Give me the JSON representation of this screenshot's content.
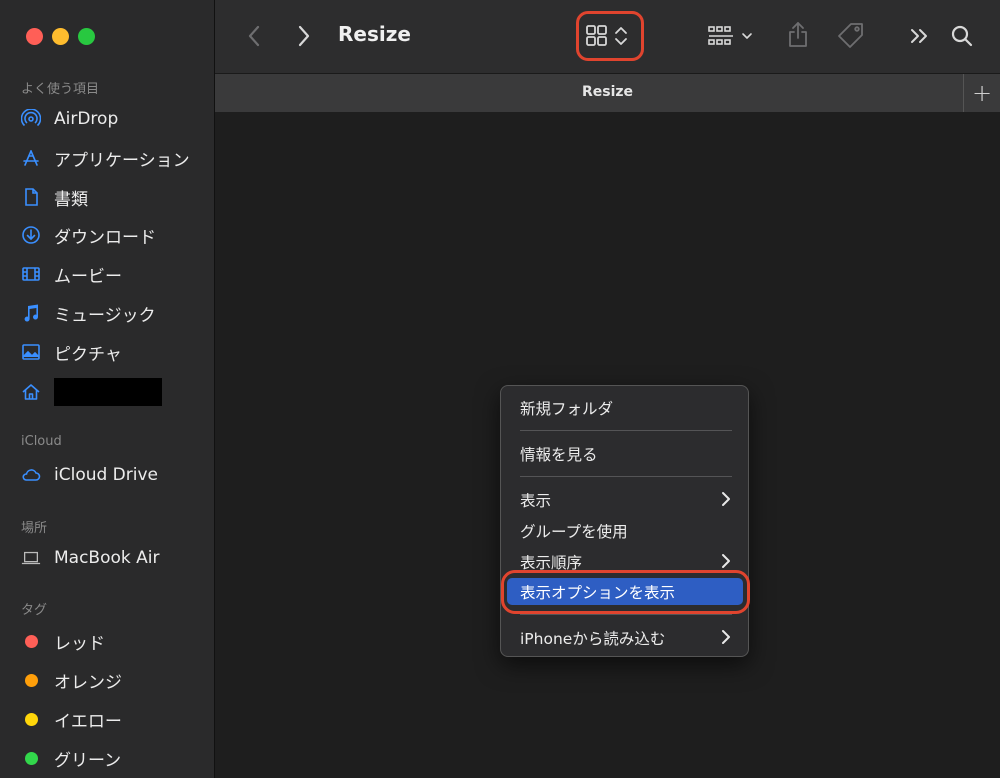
{
  "window": {
    "title": "Resize",
    "tab_title": "Resize",
    "new_tab_label": "+"
  },
  "sidebar": {
    "sections": {
      "favorites": "よく使う項目",
      "icloud": "iCloud",
      "locations": "場所",
      "tags": "タグ"
    },
    "favorites": [
      {
        "label": "AirDrop",
        "icon": "airdrop-icon"
      },
      {
        "label": "アプリケーション",
        "icon": "applications-icon"
      },
      {
        "label": "書類",
        "icon": "document-icon"
      },
      {
        "label": "ダウンロード",
        "icon": "download-icon"
      },
      {
        "label": "ムービー",
        "icon": "movie-icon"
      },
      {
        "label": "ミュージック",
        "icon": "music-icon"
      },
      {
        "label": "ピクチャ",
        "icon": "pictures-icon"
      },
      {
        "label": "",
        "icon": "home-icon",
        "redacted": true
      }
    ],
    "icloud": [
      {
        "label": "iCloud Drive",
        "icon": "cloud-icon"
      }
    ],
    "locations": [
      {
        "label": "MacBook Air",
        "icon": "laptop-icon"
      }
    ],
    "tags": [
      {
        "label": "レッド",
        "color": "#ff5f57"
      },
      {
        "label": "オレンジ",
        "color": "#ff9f0a"
      },
      {
        "label": "イエロー",
        "color": "#ffd60a"
      },
      {
        "label": "グリーン",
        "color": "#32d74b"
      }
    ]
  },
  "context_menu": {
    "items": [
      {
        "label": "新規フォルダ",
        "submenu": false
      },
      {
        "label": "情報を見る",
        "submenu": false
      },
      {
        "label": "表示",
        "submenu": true
      },
      {
        "label": "グループを使用",
        "submenu": false
      },
      {
        "label": "表示順序",
        "submenu": true
      },
      {
        "label": "表示オプションを表示",
        "submenu": false,
        "highlighted": true
      },
      {
        "label": "iPhoneから読み込む",
        "submenu": true
      }
    ]
  },
  "colors": {
    "accent_highlight": "#2e5ec3",
    "annotation_ring": "#e0442e",
    "sidebar_icon": "#3a8fff"
  }
}
